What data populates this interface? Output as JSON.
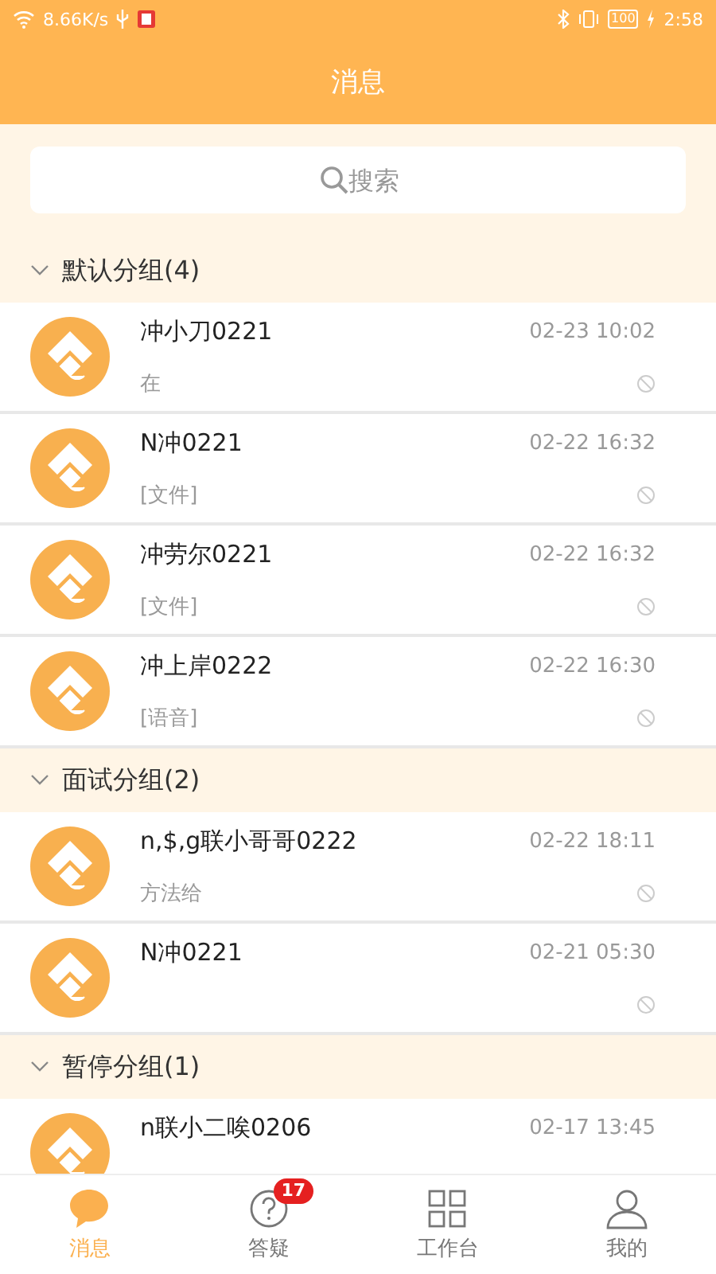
{
  "status_bar": {
    "speed": "8.66K/s",
    "battery": "100",
    "time": "2:58"
  },
  "header": {
    "title": "消息"
  },
  "search": {
    "placeholder": "搜索"
  },
  "groups": [
    {
      "name": "默认分组(4)",
      "expanded": true,
      "chats": [
        {
          "name": "冲小刀0221",
          "time": "02-23 10:02",
          "message": "在",
          "muted": true
        },
        {
          "name": "N冲0221",
          "time": "02-22 16:32",
          "message": "[文件]",
          "muted": true
        },
        {
          "name": "冲劳尔0221",
          "time": "02-22 16:32",
          "message": "[文件]",
          "muted": true
        },
        {
          "name": "冲上岸0222",
          "time": "02-22 16:30",
          "message": "[语音]",
          "muted": true
        }
      ]
    },
    {
      "name": "面试分组(2)",
      "expanded": true,
      "chats": [
        {
          "name": "n,$,g联小哥哥0222",
          "time": "02-22 18:11",
          "message": "方法给",
          "muted": true
        },
        {
          "name": "N冲0221",
          "time": "02-21 05:30",
          "muted": true
        }
      ]
    },
    {
      "name": "暂停分组(1)",
      "expanded": true,
      "chats": [
        {
          "name": "n联小二唉0206",
          "time": "02-17 13:45",
          "muted": false
        }
      ]
    }
  ],
  "tabs": [
    {
      "label": "消息",
      "kind": "chat",
      "selected": true
    },
    {
      "label": "答疑",
      "kind": "question",
      "selected": false,
      "badge": "17"
    },
    {
      "label": "工作台",
      "kind": "grid",
      "selected": false
    },
    {
      "label": "我的",
      "kind": "person",
      "selected": false
    }
  ]
}
